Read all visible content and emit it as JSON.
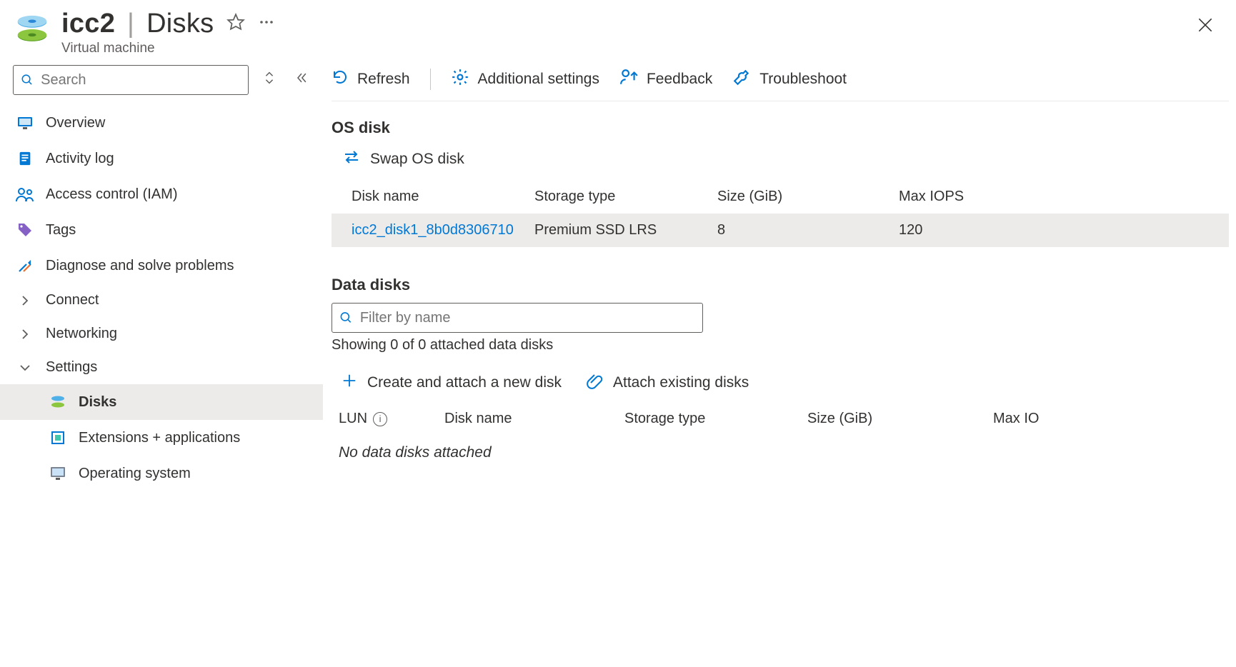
{
  "header": {
    "resource_name": "icc2",
    "section": "Disks",
    "subtype": "Virtual machine"
  },
  "sidebar": {
    "search_placeholder": "Search",
    "items": [
      {
        "icon": "monitor",
        "label": "Overview"
      },
      {
        "icon": "log",
        "label": "Activity log"
      },
      {
        "icon": "iam",
        "label": "Access control (IAM)"
      },
      {
        "icon": "tag",
        "label": "Tags"
      },
      {
        "icon": "diagnose",
        "label": "Diagnose and solve problems"
      },
      {
        "icon": "chevron",
        "label": "Connect"
      },
      {
        "icon": "chevron",
        "label": "Networking"
      },
      {
        "icon": "chevron-down",
        "label": "Settings"
      }
    ],
    "settings_children": [
      {
        "icon": "disks",
        "label": "Disks",
        "active": true
      },
      {
        "icon": "extensions",
        "label": "Extensions + applications"
      },
      {
        "icon": "os",
        "label": "Operating system"
      }
    ]
  },
  "toolbar": {
    "refresh": "Refresh",
    "additional": "Additional settings",
    "feedback": "Feedback",
    "troubleshoot": "Troubleshoot"
  },
  "os_disk": {
    "title": "OS disk",
    "swap_label": "Swap OS disk",
    "columns": {
      "name": "Disk name",
      "stype": "Storage type",
      "size": "Size (GiB)",
      "iops": "Max IOPS"
    },
    "rows": [
      {
        "name": "icc2_disk1_8b0d8306710",
        "stype": "Premium SSD LRS",
        "size": "8",
        "iops": "120"
      }
    ]
  },
  "data_disks": {
    "title": "Data disks",
    "filter_placeholder": "Filter by name",
    "showing": "Showing 0 of 0 attached data disks",
    "create_label": "Create and attach a new disk",
    "attach_label": "Attach existing disks",
    "columns": {
      "lun": "LUN",
      "name": "Disk name",
      "stype": "Storage type",
      "size": "Size (GiB)",
      "iops": "Max IO"
    },
    "empty": "No data disks attached"
  }
}
